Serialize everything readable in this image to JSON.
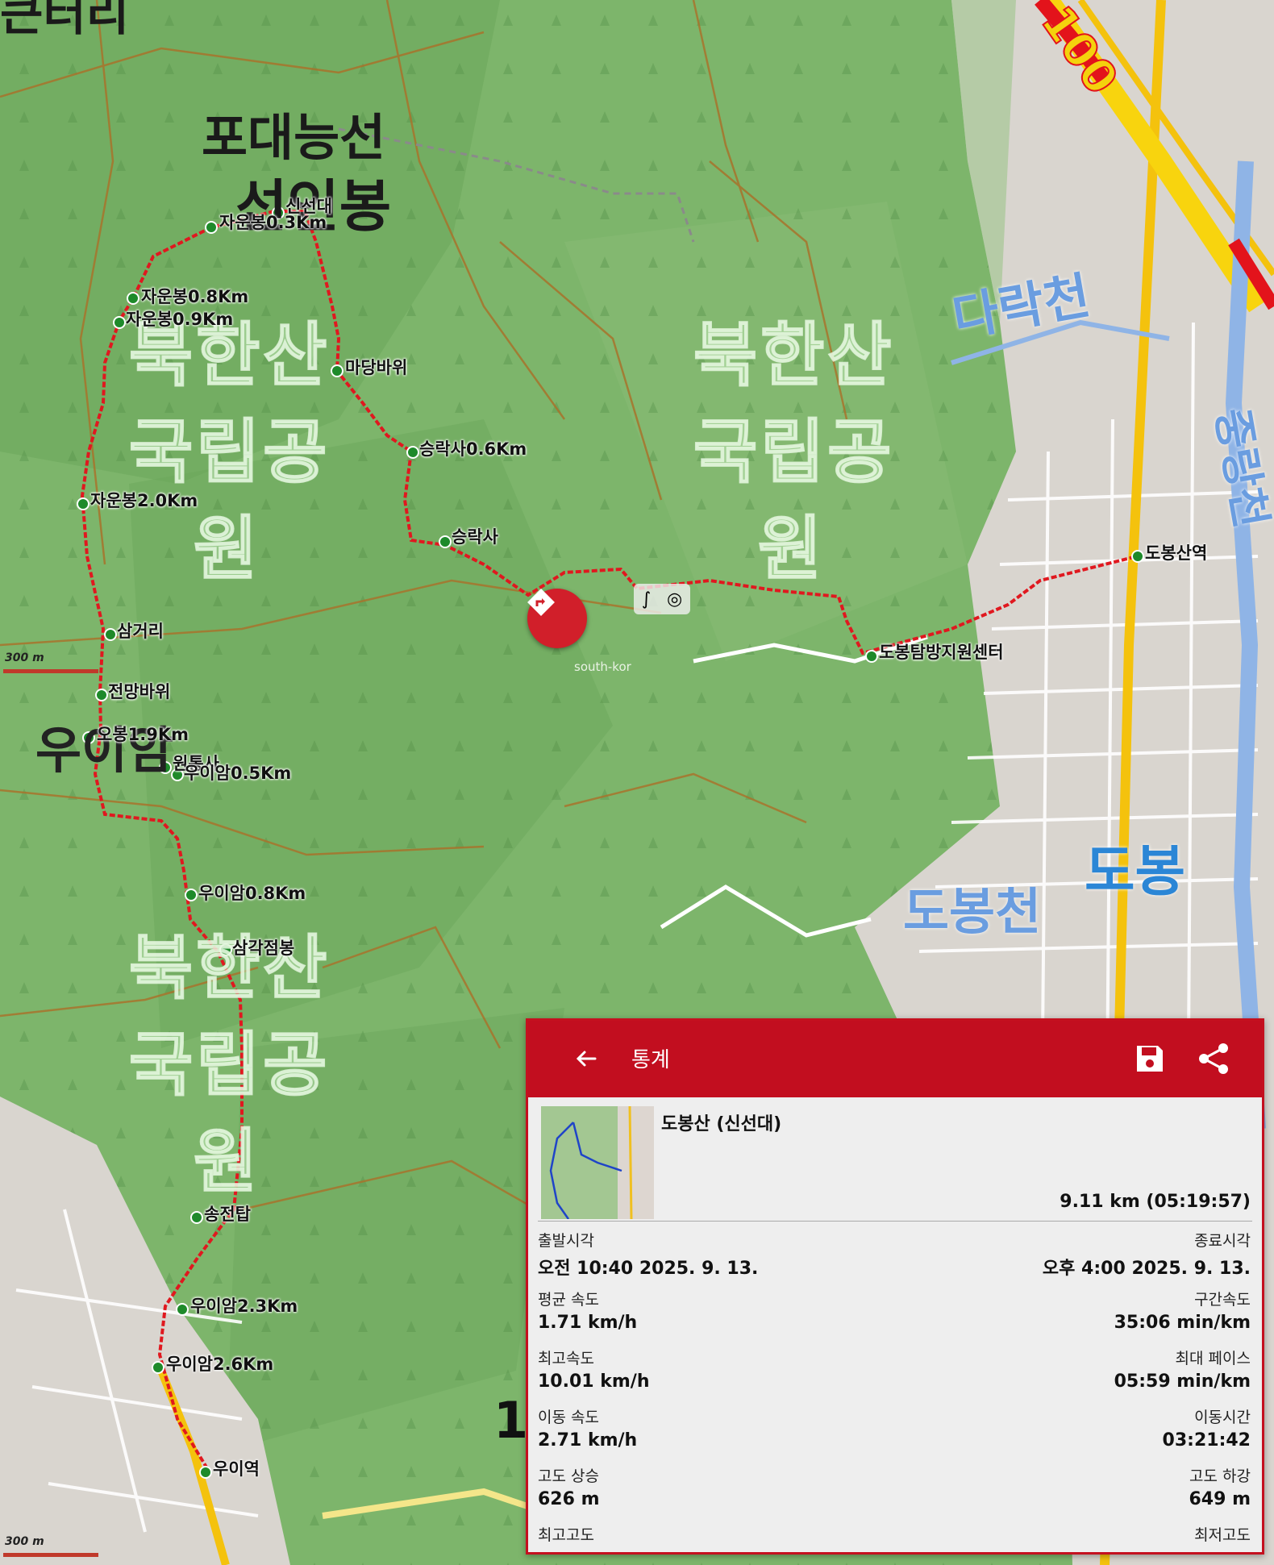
{
  "map": {
    "peak_labels": [
      "포대능선",
      "선인봉",
      "우이암"
    ],
    "park_label_lines": [
      "북한산",
      "국립공",
      "원"
    ],
    "water_labels": [
      "다락천",
      "도봉천",
      "중랑천"
    ],
    "district_label": "도봉",
    "road_number": "100",
    "side_label": "1",
    "top_left_fragment": "큰터리",
    "nav_caption": "south-kor",
    "scale_text": "300 m",
    "waypoints": [
      "신선대",
      "자운봉0.3Km",
      "자운봉0.8Km",
      "자운봉0.9Km",
      "마당바위",
      "승락사0.6Km",
      "자운봉2.0Km",
      "승락사",
      "삼거리",
      "전망바위",
      "오봉1.9Km",
      "원통사",
      "우이암0.5Km",
      "우이암0.8Km",
      "삼각점봉",
      "송전탑",
      "우이암2.3Km",
      "우이암2.6Km",
      "우이역",
      "도봉산역",
      "도봉탐방지원센터"
    ]
  },
  "panel": {
    "title": "통계",
    "icons": {
      "back": "arrow-back-icon",
      "save": "floppy-disk-icon",
      "share": "share-icon"
    },
    "track_name": "도봉산 (신선대)",
    "summary": "9.11 km (05:19:57)",
    "stats": [
      {
        "left_label": "출발시각",
        "left_value": "오전 10:40 2025. 9. 13.",
        "right_label": "종료시각",
        "right_value": "오후 4:00 2025. 9. 13."
      },
      {
        "left_label": "평균 속도",
        "left_value": "1.71 km/h",
        "right_label": "구간속도",
        "right_value": "35:06 min/km"
      },
      {
        "left_label": "최고속도",
        "left_value": "10.01 km/h",
        "right_label": "최대 페이스",
        "right_value": "05:59 min/km"
      },
      {
        "left_label": "이동 속도",
        "left_value": "2.71 km/h",
        "right_label": "이동시간",
        "right_value": "03:21:42"
      },
      {
        "left_label": "고도 상승",
        "left_value": "626 m",
        "right_label": "고도 하강",
        "right_value": "649 m"
      },
      {
        "left_label": "최고고도",
        "left_value": "",
        "right_label": "최저고도",
        "right_value": ""
      }
    ]
  },
  "colors": {
    "accent": "#c20e1f",
    "track": "#e0181f",
    "map_green": "#7fb26a"
  }
}
